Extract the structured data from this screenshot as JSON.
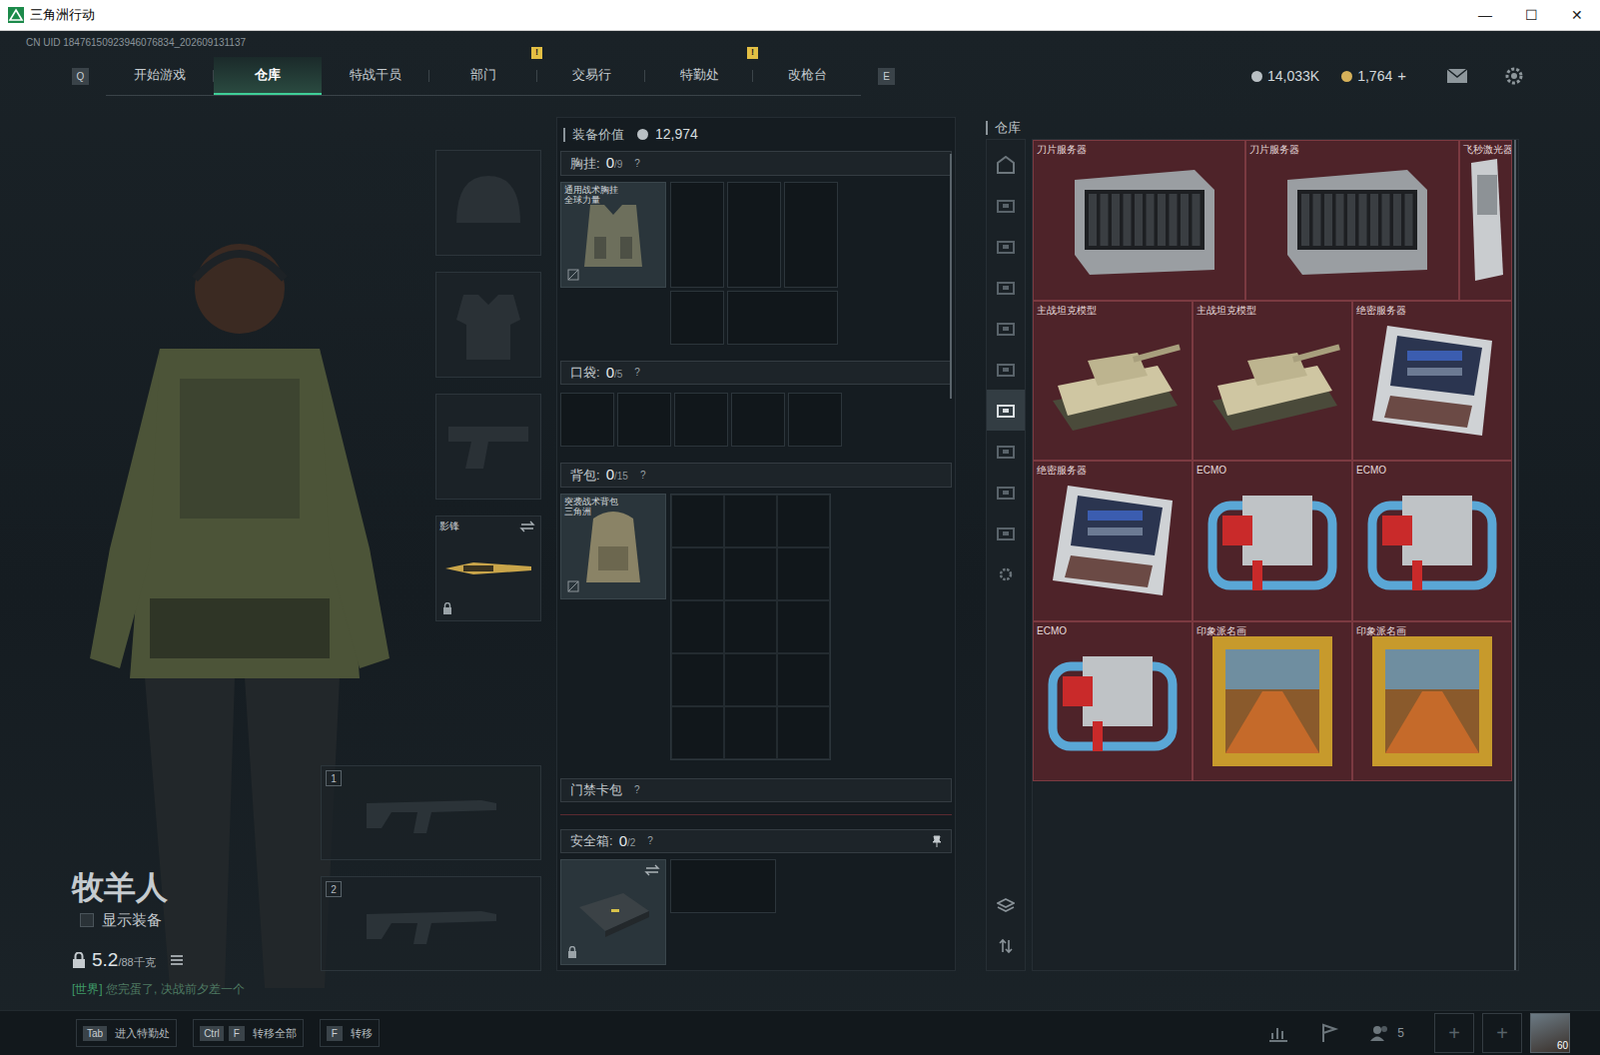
{
  "window": {
    "title": "三角洲行动",
    "controls": [
      "—",
      "☐",
      "✕"
    ]
  },
  "uid": "CN UID 18476150923946076834_202609131137",
  "nav": {
    "prev_key": "Q",
    "next_key": "E",
    "alert_glyph": "!",
    "tabs": [
      {
        "label": "开始游戏",
        "selected": false,
        "alert": false
      },
      {
        "label": "仓库",
        "selected": true,
        "alert": false
      },
      {
        "label": "特战干员",
        "selected": false,
        "alert": false
      },
      {
        "label": "部门",
        "selected": false,
        "alert": true
      },
      {
        "label": "交易行",
        "selected": false,
        "alert": false
      },
      {
        "label": "特勤处",
        "selected": false,
        "alert": true
      },
      {
        "label": "改枪台",
        "selected": false,
        "alert": false
      }
    ]
  },
  "currency": [
    {
      "kind": "coin",
      "value": "14,033K",
      "action": ""
    },
    {
      "kind": "token",
      "value": "1,764",
      "action": "+"
    }
  ],
  "operator": {
    "name": "牧羊人",
    "show_gear": {
      "label": "显示装备",
      "checked": false
    },
    "weight": "5.2",
    "weight_max": "/88千克",
    "chat": {
      "channel": "[世界]",
      "text": "您完蛋了, 决战前夕差一个"
    }
  },
  "gear_slots": [
    {
      "kind": "helmet",
      "filled": false,
      "label": "",
      "locked": false
    },
    {
      "kind": "armor",
      "filled": false,
      "label": "",
      "locked": false
    },
    {
      "kind": "pistol",
      "filled": false,
      "label": "",
      "locked": false
    },
    {
      "kind": "melee",
      "filled": true,
      "label": "影锋",
      "locked": true
    }
  ],
  "weapon_slots": [
    {
      "index": "1",
      "filled": false
    },
    {
      "index": "2",
      "filled": false
    }
  ],
  "loadout": {
    "value_label": "装备价值",
    "value": "12,974",
    "chest": {
      "title": "胸挂:",
      "count": "0",
      "capacity": "/9",
      "help": "?",
      "item": [
        "通用战术胸挂",
        "全球力量"
      ],
      "locked": false
    },
    "pockets": {
      "title": "口袋:",
      "count": "0",
      "capacity": "/5",
      "help": "?"
    },
    "backpack": {
      "title": "背包:",
      "count": "0",
      "capacity": "/15",
      "help": "?",
      "item": [
        "突袭战术背包",
        "三角洲"
      ]
    },
    "keycard": {
      "title": "门禁卡包",
      "help": "?"
    },
    "safebox": {
      "title": "安全箱:",
      "count": "0",
      "capacity": "/2",
      "help": "?",
      "pinned": true,
      "locked": true
    }
  },
  "warehouse": {
    "title": "仓库",
    "tabs": [
      {
        "kind": "home",
        "selected": false
      },
      {
        "kind": "box",
        "selected": false
      },
      {
        "kind": "box",
        "selected": false
      },
      {
        "kind": "box",
        "selected": false
      },
      {
        "kind": "box",
        "selected": false
      },
      {
        "kind": "box",
        "selected": false
      },
      {
        "kind": "box",
        "selected": true
      },
      {
        "kind": "box",
        "selected": false
      },
      {
        "kind": "box",
        "selected": false
      },
      {
        "kind": "box",
        "selected": false
      },
      {
        "kind": "gear",
        "selected": false
      }
    ],
    "items": [
      {
        "name": "刀片服务器",
        "kind": "blade-server"
      },
      {
        "name": "刀片服务器",
        "kind": "blade-server"
      },
      {
        "name": "飞秒激光器",
        "kind": "laser"
      },
      {
        "name": "主战坦克模型",
        "kind": "tank"
      },
      {
        "name": "主战坦克模型",
        "kind": "tank"
      },
      {
        "name": "绝密服务器",
        "kind": "server"
      },
      {
        "name": "绝密服务器",
        "kind": "server"
      },
      {
        "name": "ECMO",
        "kind": "ecmo"
      },
      {
        "name": "ECMO",
        "kind": "ecmo"
      },
      {
        "name": "ECMO",
        "kind": "ecmo"
      },
      {
        "name": "印象派名画",
        "kind": "painting"
      },
      {
        "name": "印象派名画",
        "kind": "painting"
      }
    ]
  },
  "bottom_bar": {
    "hints": [
      {
        "keys": [
          "Tab"
        ],
        "label": "进入特勤处"
      },
      {
        "keys": [
          "Ctrl",
          "F"
        ],
        "label": "转移全部"
      },
      {
        "keys": [
          "F"
        ],
        "label": "转移"
      }
    ],
    "squad_count": "5",
    "invites": [
      "+",
      "+"
    ],
    "level": "60"
  }
}
